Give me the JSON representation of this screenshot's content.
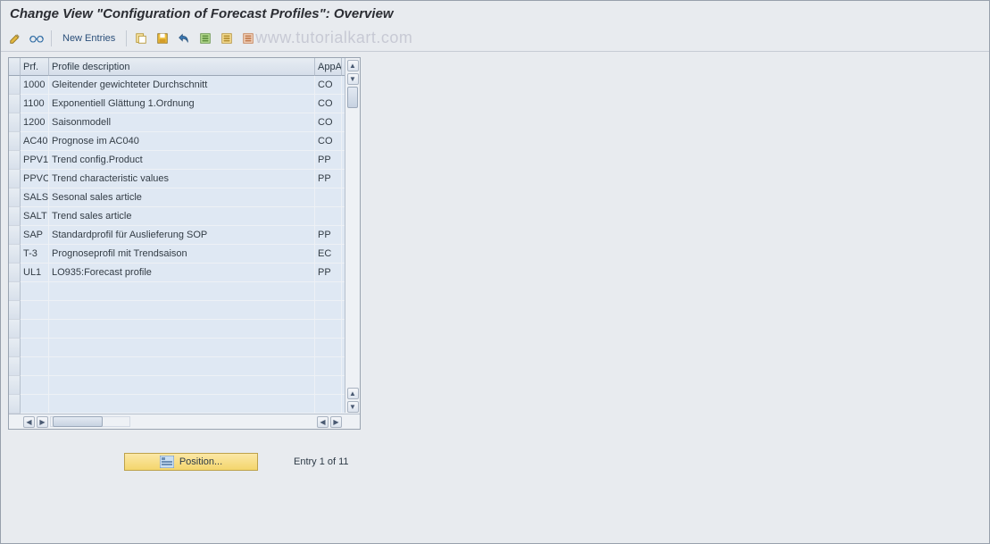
{
  "title": "Change View \"Configuration of Forecast Profiles\": Overview",
  "toolbar": {
    "new_entries_label": "New Entries"
  },
  "watermark": "www.tutorialkart.com",
  "table": {
    "col_prf": "Prf.",
    "col_desc": "Profile description",
    "col_app": "AppA",
    "rows": [
      {
        "prf": "1000",
        "desc": "Gleitender gewichteter Durchschnitt",
        "app": "CO"
      },
      {
        "prf": "1100",
        "desc": "Exponentiell Glättung 1.Ordnung",
        "app": "CO"
      },
      {
        "prf": "1200",
        "desc": "Saisonmodell",
        "app": "CO"
      },
      {
        "prf": "AC40",
        "desc": "Prognose im AC040",
        "app": "CO"
      },
      {
        "prf": "PPV1",
        "desc": "Trend config.Product",
        "app": "PP"
      },
      {
        "prf": "PPVC",
        "desc": "Trend characteristic values",
        "app": "PP"
      },
      {
        "prf": "SALS",
        "desc": "Sesonal sales article",
        "app": ""
      },
      {
        "prf": "SALT",
        "desc": "Trend sales article",
        "app": ""
      },
      {
        "prf": "SAP",
        "desc": "Standardprofil für Auslieferung SOP",
        "app": "PP"
      },
      {
        "prf": "T-3",
        "desc": "Prognoseprofil mit Trendsaison",
        "app": "EC"
      },
      {
        "prf": "UL1",
        "desc": "LO935:Forecast profile",
        "app": "PP"
      }
    ]
  },
  "footer": {
    "position_label": "Position...",
    "entry_text": "Entry 1 of 11"
  }
}
